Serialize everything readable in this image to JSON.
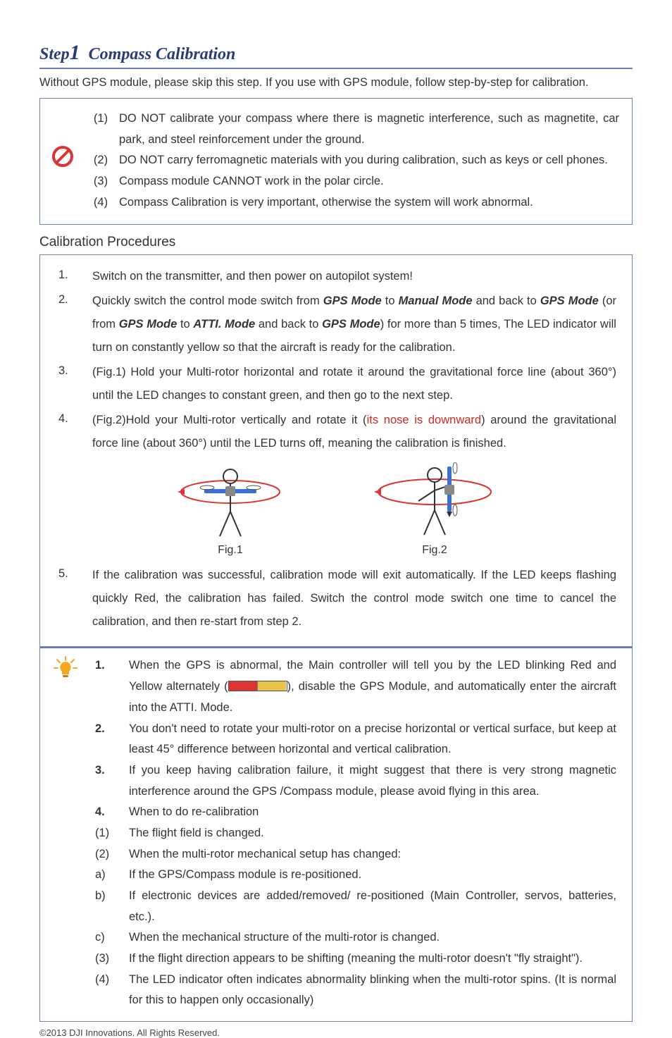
{
  "step": {
    "prefix": "Step",
    "number": "1",
    "title": "Compass Calibration"
  },
  "intro": "Without GPS module, please skip this step. If you use with GPS module, follow step-by-step for calibration.",
  "warnings": [
    {
      "n": "(1)",
      "text": "DO NOT calibrate your compass where there is magnetic interference, such as magnetite, car park, and steel reinforcement under the ground."
    },
    {
      "n": "(2)",
      "text": "DO NOT carry ferromagnetic materials with you during calibration, such as keys or cell phones."
    },
    {
      "n": "(3)",
      "text": "Compass module CANNOT work in the polar circle."
    },
    {
      "n": "(4)",
      "text": "Compass Calibration is very important, otherwise the system will work abnormal."
    }
  ],
  "procedures_heading": "Calibration Procedures",
  "procedures": [
    {
      "n": "1.",
      "parts": [
        {
          "t": "Switch on the transmitter, and then power on autopilot system!"
        }
      ]
    },
    {
      "n": "2.",
      "parts": [
        {
          "t": "Quickly switch the control mode switch from "
        },
        {
          "t": "GPS Mode",
          "cls": "em-bi"
        },
        {
          "t": " to "
        },
        {
          "t": "Manual Mode",
          "cls": "em-bi"
        },
        {
          "t": " and back to "
        },
        {
          "t": "GPS Mode",
          "cls": "em-bi"
        },
        {
          "t": " (or from "
        },
        {
          "t": "GPS Mode",
          "cls": "em-bi"
        },
        {
          "t": " to "
        },
        {
          "t": "ATTI. Mode",
          "cls": "em-bi"
        },
        {
          "t": " and back to "
        },
        {
          "t": "GPS Mode",
          "cls": "em-bi"
        },
        {
          "t": ") for more than 5 times, The LED indicator will turn on constantly yellow so that the aircraft is ready for the calibration."
        }
      ]
    },
    {
      "n": "3.",
      "parts": [
        {
          "t": "(Fig.1) Hold your Multi-rotor horizontal and rotate it around the gravitational force line (about 360°) until the LED changes to constant green, and then go to the next step."
        }
      ]
    },
    {
      "n": "4.",
      "parts": [
        {
          "t": "(Fig.2)Hold your Multi-rotor vertically and rotate it ("
        },
        {
          "t": "its nose is downward",
          "cls": "red"
        },
        {
          "t": ") around the gravitational force line (about 360°) until the LED turns off, meaning the calibration is finished."
        }
      ]
    }
  ],
  "figures": {
    "fig1": "Fig.1",
    "fig2": "Fig.2"
  },
  "procedure5": {
    "n": "5.",
    "text": "If the calibration was successful, calibration mode will exit automatically. If the LED keeps flashing quickly Red, the calibration has failed. Switch the control mode switch one time to cancel the calibration, and then re-start from step 2."
  },
  "tips": [
    {
      "n": "1.",
      "pre": "When the GPS is abnormal, the Main controller will tell you by the LED blinking Red and Yellow alternately (",
      "post": "), disable the GPS Module, and automatically enter the aircraft into the ATTI. Mode."
    },
    {
      "n": "2.",
      "text": "You don't need to rotate your multi-rotor on a precise horizontal or vertical surface, but keep at least 45° difference between horizontal and vertical calibration."
    },
    {
      "n": "3.",
      "text": "If you keep having calibration failure, it might suggest that there is very strong magnetic interference around the GPS /Compass module, please avoid flying in this area."
    },
    {
      "n": "4.",
      "text": "When to do re-calibration"
    }
  ],
  "tip4_sub": [
    {
      "n": "(1)",
      "t": "The flight field is changed."
    },
    {
      "n": "(2)",
      "t": "When the multi-rotor mechanical setup has changed:"
    },
    {
      "n": "a)",
      "t": "If the GPS/Compass module is re-positioned."
    },
    {
      "n": "b)",
      "t": "If electronic devices are added/removed/ re-positioned (Main Controller, servos, batteries, etc.)."
    },
    {
      "n": "c)",
      "t": "When the mechanical structure of the multi-rotor is changed."
    },
    {
      "n": "(3)",
      "t": "If the flight direction appears to be shifting (meaning the multi-rotor doesn't \"fly straight\")."
    },
    {
      "n": "(4)",
      "t": "The LED indicator often indicates abnormality blinking when the multi-rotor spins. (It is normal for this to happen only occasionally)"
    }
  ],
  "footer": "©2013 DJI Innovations. All Rights Reserved."
}
